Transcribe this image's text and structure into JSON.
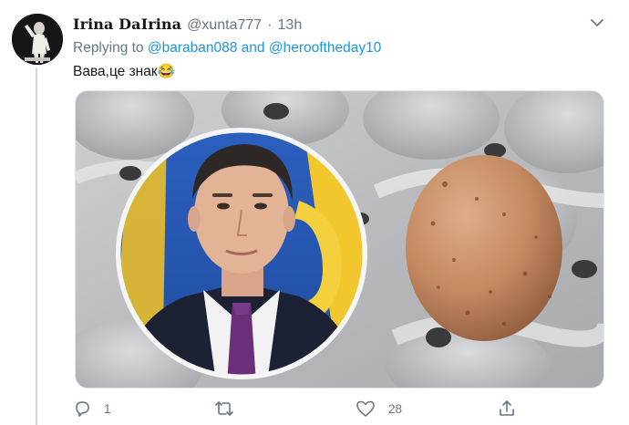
{
  "tweet": {
    "display_name": "Irina DaIrina",
    "handle": "@xunta777",
    "separator": "·",
    "time": "13h",
    "replying_prefix": "Replying to",
    "mention_1": "@baraban088",
    "conjunction": "and",
    "mention_2": "@herooftheday10",
    "text": "Вава,це знак😂",
    "menu_icon": "chevron-down-icon",
    "media_description_icons": [
      "egg-carton",
      "portrait-circle"
    ]
  },
  "actions": {
    "reply": {
      "icon": "reply-icon",
      "count": "1"
    },
    "retweet": {
      "icon": "retweet-icon",
      "count": ""
    },
    "like": {
      "icon": "heart-icon",
      "count": "28"
    },
    "share": {
      "icon": "share-icon",
      "count": ""
    }
  },
  "colors": {
    "link": "#1b95e0",
    "secondary_text": "#657786",
    "primary_text": "#14171a",
    "thread_line": "#ccd6dd"
  }
}
